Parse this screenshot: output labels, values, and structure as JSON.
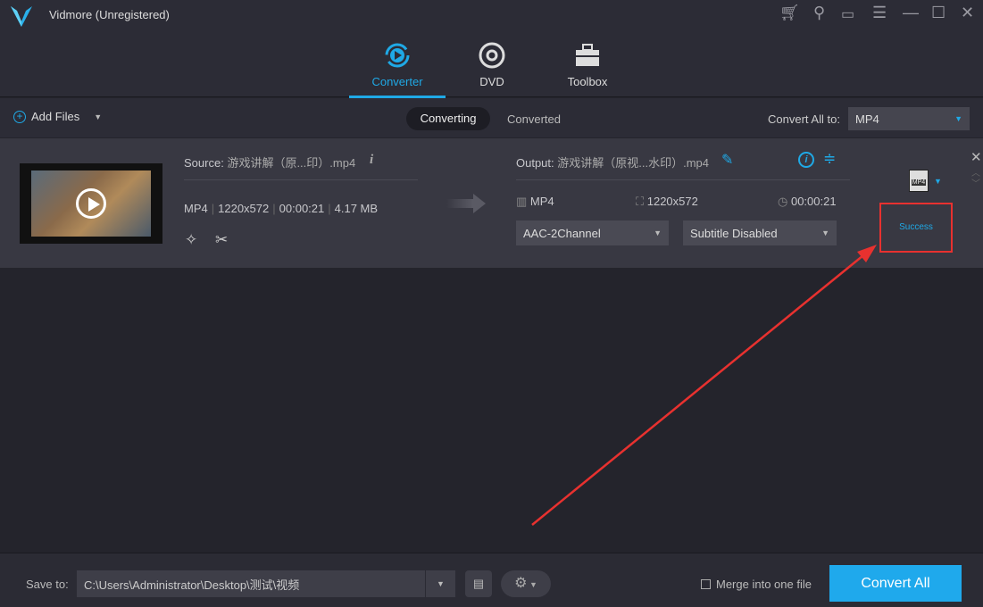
{
  "app": {
    "title": "Vidmore (Unregistered)",
    "accent": "#1fa9e6"
  },
  "window_controls": [
    "cart-icon",
    "key-icon",
    "feedback-icon",
    "menu-icon",
    "minimize-icon",
    "maximize-icon",
    "close-icon"
  ],
  "nav": {
    "tabs": [
      {
        "label": "Converter",
        "active": true
      },
      {
        "label": "DVD"
      },
      {
        "label": "Toolbox"
      }
    ]
  },
  "toolbar": {
    "add_files": "Add Files",
    "segments": [
      "Converting",
      "Converted"
    ],
    "convert_all_to_label": "Convert All to:",
    "convert_all_to_value": "MP4"
  },
  "file": {
    "source_label": "Source:",
    "source_name": "游戏讲解（原...印）.mp4",
    "format": "MP4",
    "resolution": "1220x572",
    "duration": "00:00:21",
    "size": "4.17 MB",
    "output_label": "Output:",
    "output_name": "游戏讲解（原视...水印）.mp4",
    "out_format": "MP4",
    "out_resolution": "1220x572",
    "out_duration": "00:00:21",
    "audio": "AAC-2Channel",
    "subtitle": "Subtitle Disabled",
    "format_badge": "MP4",
    "status": "Success"
  },
  "footer": {
    "save_to_label": "Save to:",
    "save_path": "C:\\Users\\Administrator\\Desktop\\测试\\视频",
    "merge_label": "Merge into one file",
    "convert_all": "Convert All"
  }
}
